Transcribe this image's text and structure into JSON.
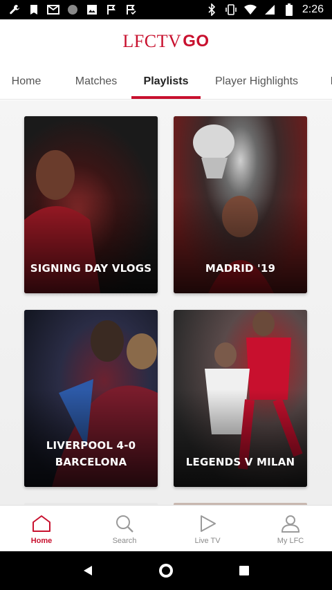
{
  "status_bar": {
    "time": "2:26",
    "left_icons": [
      "wrench-icon",
      "bookmark-icon",
      "gmail-icon",
      "circle-icon",
      "image-icon",
      "flag-icon",
      "flag-check-icon"
    ],
    "right_icons": [
      "bluetooth-icon",
      "vibrate-icon",
      "wifi-icon",
      "signal-icon",
      "battery-icon"
    ]
  },
  "header": {
    "logo_text": "LFCTV",
    "logo_go": "GO",
    "brand_color": "#c8102e"
  },
  "tabs": [
    {
      "label": "Home",
      "active": false
    },
    {
      "label": "Matches",
      "active": false
    },
    {
      "label": "Playlists",
      "active": true
    },
    {
      "label": "Player Highlights",
      "active": false
    },
    {
      "label": "B",
      "active": false
    }
  ],
  "playlists": [
    {
      "title_line1": "SIGNING DAY VLOGS",
      "title_line2": ""
    },
    {
      "title_line1": "MADRID '19",
      "title_line2": ""
    },
    {
      "title_line1": "LIVERPOOL 4-0",
      "title_line2": "BARCELONA"
    },
    {
      "title_line1": "LEGENDS V MILAN",
      "title_line2": ""
    }
  ],
  "bottom_nav": [
    {
      "label": "Home",
      "icon": "home-icon",
      "active": true
    },
    {
      "label": "Search",
      "icon": "search-icon",
      "active": false
    },
    {
      "label": "Live TV",
      "icon": "play-icon",
      "active": false
    },
    {
      "label": "My LFC",
      "icon": "user-icon",
      "active": false
    }
  ],
  "system_nav": [
    "back-icon",
    "home-circle-icon",
    "recents-icon"
  ]
}
